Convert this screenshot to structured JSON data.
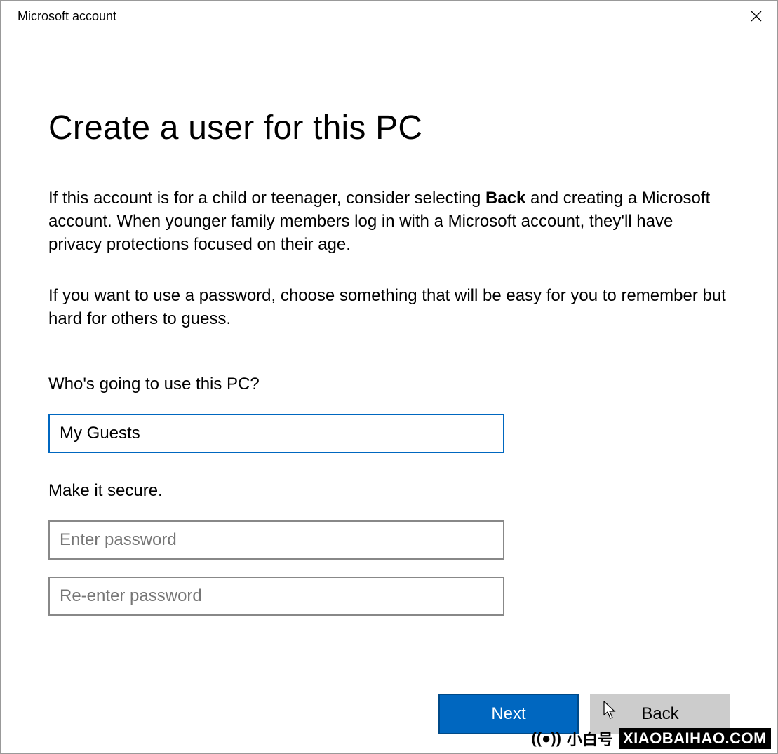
{
  "window": {
    "title": "Microsoft account"
  },
  "heading": "Create a user for this PC",
  "paragraph1_pre": "If this account is for a child or teenager, consider selecting ",
  "paragraph1_bold": "Back",
  "paragraph1_post": " and creating a Microsoft account. When younger family members log in with a Microsoft account, they'll have privacy protections focused on their age.",
  "paragraph2": "If you want to use a password, choose something that will be easy for you to remember but hard for others to guess.",
  "who_label": "Who's going to use this PC?",
  "username_value": "My Guests",
  "secure_label": "Make it secure.",
  "password_placeholder": "Enter password",
  "reenter_placeholder": "Re-enter password",
  "buttons": {
    "next": "Next",
    "back": "Back"
  },
  "branding": {
    "name": "小白号",
    "domain": "XIAOBAIHAO.COM"
  }
}
